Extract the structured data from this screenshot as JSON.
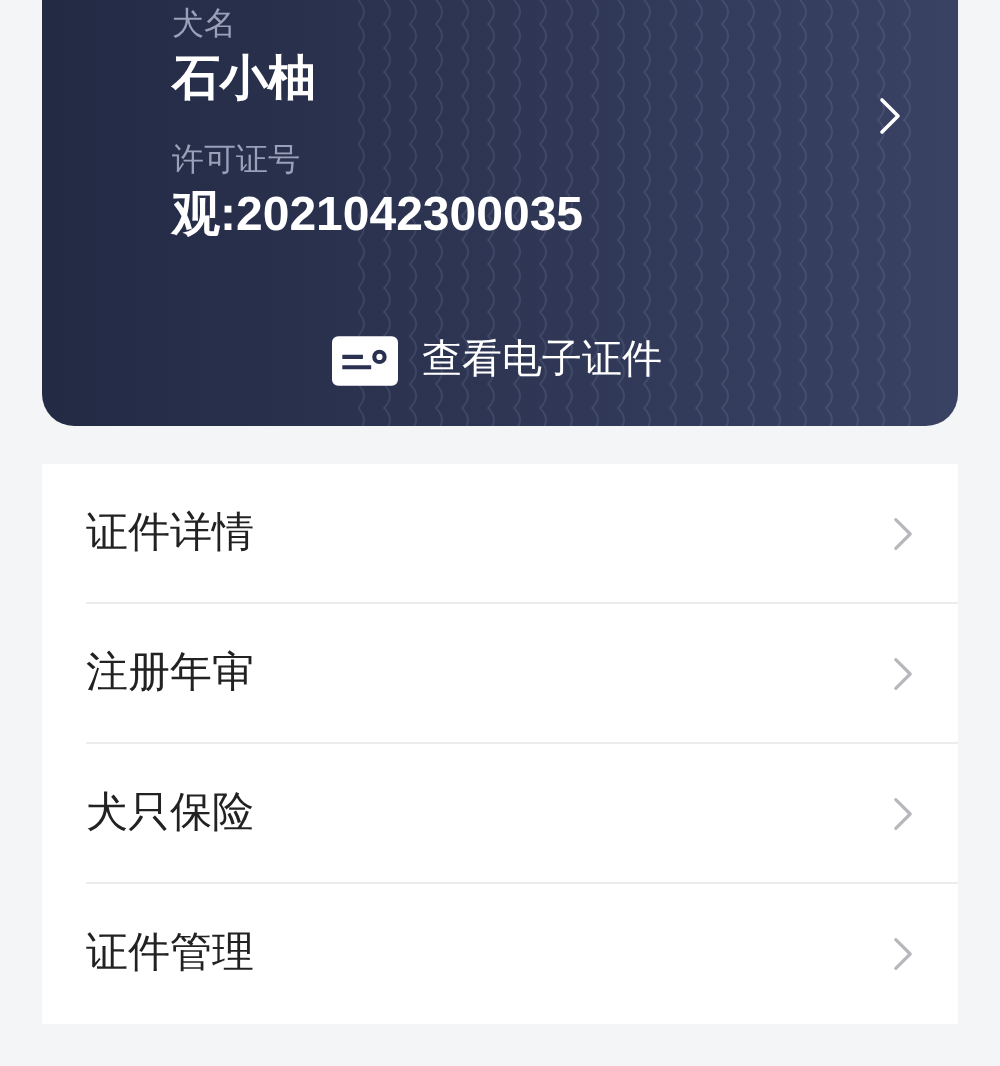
{
  "card": {
    "name_label": "犬名",
    "name": "石小柚",
    "license_label": "许可证号",
    "license": "观:2021042300035",
    "view_button": "查看电子证件"
  },
  "menu": [
    {
      "label": "证件详情"
    },
    {
      "label": "注册年审"
    },
    {
      "label": "犬只保险"
    },
    {
      "label": "证件管理"
    }
  ]
}
